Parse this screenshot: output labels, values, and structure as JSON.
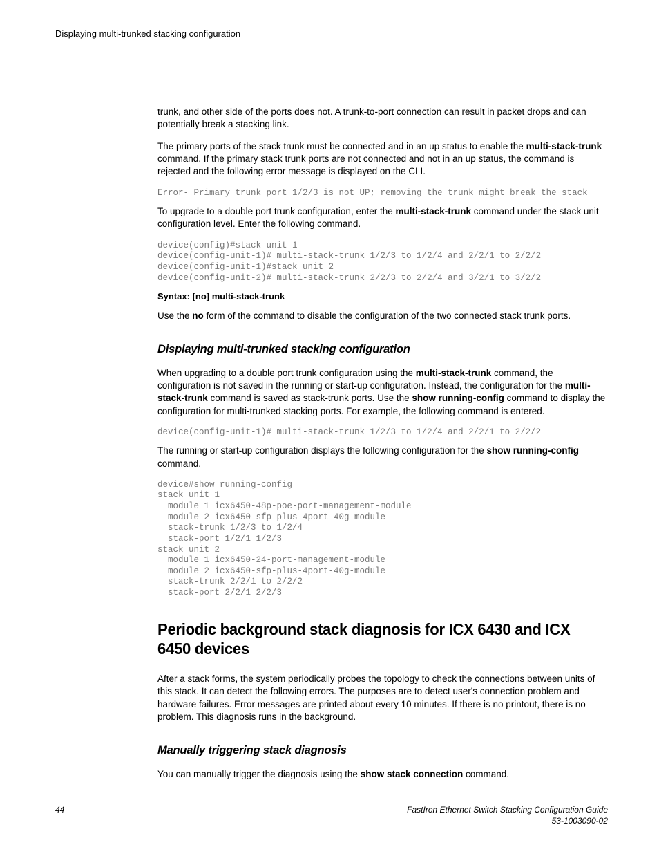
{
  "header": {
    "running": "Displaying multi-trunked stacking configuration"
  },
  "body": {
    "p1a": "trunk, and other side of the ports does not. A trunk-to-port connection can result in packet drops and can potentially break a stacking link.",
    "p2_pre": "The primary ports of the stack trunk must be connected and in an up status to enable the ",
    "p2_b1": "multi-stack-trunk",
    "p2_post": " command. If the primary stack trunk ports are not connected and not in an up status, the command is rejected and the following error message is displayed on the CLI.",
    "code1": "Error- Primary trunk port 1/2/3 is not UP; removing the trunk might break the stack",
    "p3_pre": "To upgrade to a double port trunk configuration, enter the ",
    "p3_b1": "multi-stack-trunk",
    "p3_post": " command under the stack unit configuration level. Enter the following command.",
    "code2": "device(config)#stack unit 1\ndevice(config-unit-1)# multi-stack-trunk 1/2/3 to 1/2/4 and 2/2/1 to 2/2/2\ndevice(config-unit-1)#stack unit 2\ndevice(config-unit-2)# multi-stack-trunk 2/2/3 to 2/2/4 and 3/2/1 to 3/2/2",
    "syntax": "Syntax: [no] multi-stack-trunk",
    "p4_pre": "Use the ",
    "p4_b1": "no",
    "p4_post": " form of the command to disable the configuration of the two connected stack trunk ports.",
    "h2a": "Displaying multi-trunked stacking configuration",
    "p5_a": "When upgrading to a double port trunk configuration using the ",
    "p5_b1": "multi-stack-trunk",
    "p5_b": " command, the configuration is not saved in the running or start-up configuration. Instead, the configuration for the ",
    "p5_b2": "multi-stack-trunk",
    "p5_c": " command is saved as stack-trunk ports. Use the ",
    "p5_b3": "show running-config",
    "p5_d": " command to display the configuration for multi-trunked stacking ports. For example, the following command is entered.",
    "code3": "device(config-unit-1)# multi-stack-trunk 1/2/3 to 1/2/4 and 2/2/1 to 2/2/2",
    "p6_a": "The running or start-up configuration displays the following configuration for the ",
    "p6_b1": "show running-config",
    "p6_b": " command.",
    "code4": "device#show running-config\nstack unit 1\n  module 1 icx6450-48p-poe-port-management-module\n  module 2 icx6450-sfp-plus-4port-40g-module\n  stack-trunk 1/2/3 to 1/2/4\n  stack-port 1/2/1 1/2/3\nstack unit 2\n  module 1 icx6450-24-port-management-module\n  module 2 icx6450-sfp-plus-4port-40g-module\n  stack-trunk 2/2/1 to 2/2/2\n  stack-port 2/2/1 2/2/3",
    "h1": "Periodic background stack diagnosis for ICX 6430 and ICX 6450 devices",
    "p7": "After a stack forms, the system periodically probes the topology to check the connections between units of this stack. It can detect the following errors. The purposes are to detect user's connection problem and hardware failures. Error messages are printed about every 10 minutes. If there is no printout, there is no problem. This diagnosis runs in the background.",
    "h2b": "Manually triggering stack diagnosis",
    "p8_a": "You can manually trigger the diagnosis using the ",
    "p8_b1": "show stack connection",
    "p8_b": " command."
  },
  "footer": {
    "page": "44",
    "title": "FastIron Ethernet Switch Stacking Configuration Guide",
    "docnum": "53-1003090-02"
  }
}
